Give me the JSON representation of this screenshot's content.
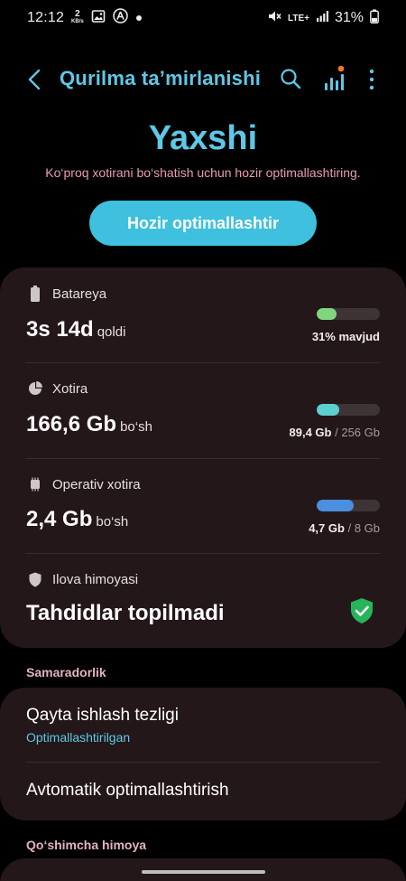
{
  "status_bar": {
    "time": "12:12",
    "speed_value": "2",
    "speed_unit": "KB/s",
    "network": "LTE+",
    "battery": "31%",
    "icons": [
      "image-icon",
      "accessibility-icon",
      "dot-icon",
      "mute-icon",
      "signal-icon",
      "battery-icon"
    ]
  },
  "header": {
    "title": "Qurilma ta’mirlanishi",
    "icons": [
      "back-arrow-icon",
      "search-icon",
      "stats-icon",
      "more-icon"
    ]
  },
  "hero": {
    "status": "Yaxshi",
    "subtitle": "Ko‘proq xotirani bo‘shatish uchun hozir optimallashtiring.",
    "button": "Hozir optimallashtir"
  },
  "battery": {
    "label": "Batareya",
    "value": "3s 14d",
    "unit": "qoldi",
    "level_percent": 31,
    "bar_text": "31% mavjud",
    "color": "#7fd67f"
  },
  "storage": {
    "label": "Xotira",
    "value": "166,6 Gb",
    "unit": "bo‘sh",
    "used": "89,4 Gb",
    "separator": "/",
    "total": "256 Gb",
    "used_fraction": 0.35,
    "color": "#5ccfd0"
  },
  "ram": {
    "label": "Operativ xotira",
    "value": "2,4 Gb",
    "unit": "bo‘sh",
    "used": "4,7 Gb",
    "separator": "/",
    "total": "8 Gb",
    "used_fraction": 0.59,
    "color": "#4b8fe0"
  },
  "app_protection": {
    "label": "Ilova himoyasi",
    "value": "Tahdidlar topilmadi",
    "status_color": "#27b55a"
  },
  "performance": {
    "group_label": "Samaradorlik",
    "items": [
      {
        "title": "Qayta ishlash tezligi",
        "subtitle": "Optimallashtirilgan"
      },
      {
        "title": "Avtomatik optimallashtirish"
      }
    ]
  },
  "extra": {
    "group_label": "Qo‘shimcha himoya"
  },
  "colors": {
    "accent": "#5fc8e6",
    "button": "#3ec0de",
    "card": "#241719",
    "subtitle_pink": "#ec9bb4"
  }
}
